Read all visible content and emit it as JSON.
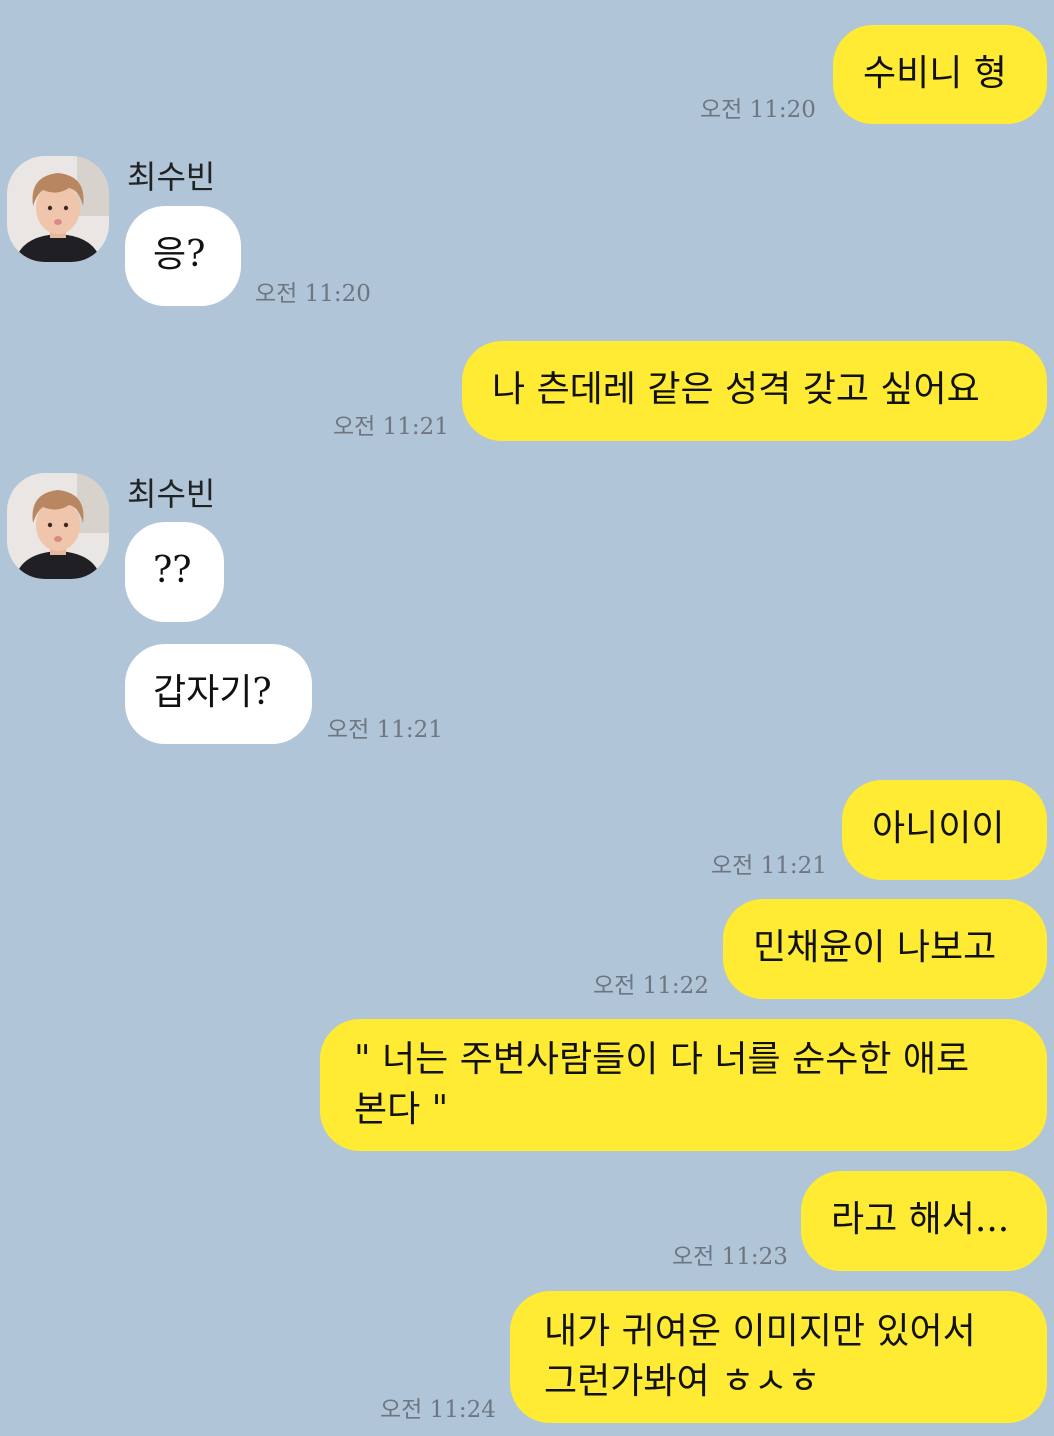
{
  "sender_name": "최수빈",
  "messages": [
    {
      "from": "me",
      "text": "수비니 형",
      "time": "오전 11:20"
    },
    {
      "from": "them",
      "text": "응?",
      "time": "오전 11:20"
    },
    {
      "from": "me",
      "text": "나 츤데레 같은 성격 갖고 싶어요",
      "time": "오전 11:21"
    },
    {
      "from": "them",
      "text": "??",
      "time": ""
    },
    {
      "from": "them",
      "text": "갑자기?",
      "time": "오전 11:21"
    },
    {
      "from": "me",
      "text": "아니이이",
      "time": "오전 11:21"
    },
    {
      "from": "me",
      "text": "민채윤이 나보고",
      "time": "오전 11:22"
    },
    {
      "from": "me",
      "text": "\" 너는 주변사람들이 다 너를 순수한 애로 본다 \"",
      "time": ""
    },
    {
      "from": "me",
      "text": "라고 해서...",
      "time": "오전 11:23"
    },
    {
      "from": "me",
      "text": "내가 귀여운 이미지만 있어서 그런가봐여 ㅎㅅㅎ",
      "time": "오전 11:24"
    }
  ]
}
